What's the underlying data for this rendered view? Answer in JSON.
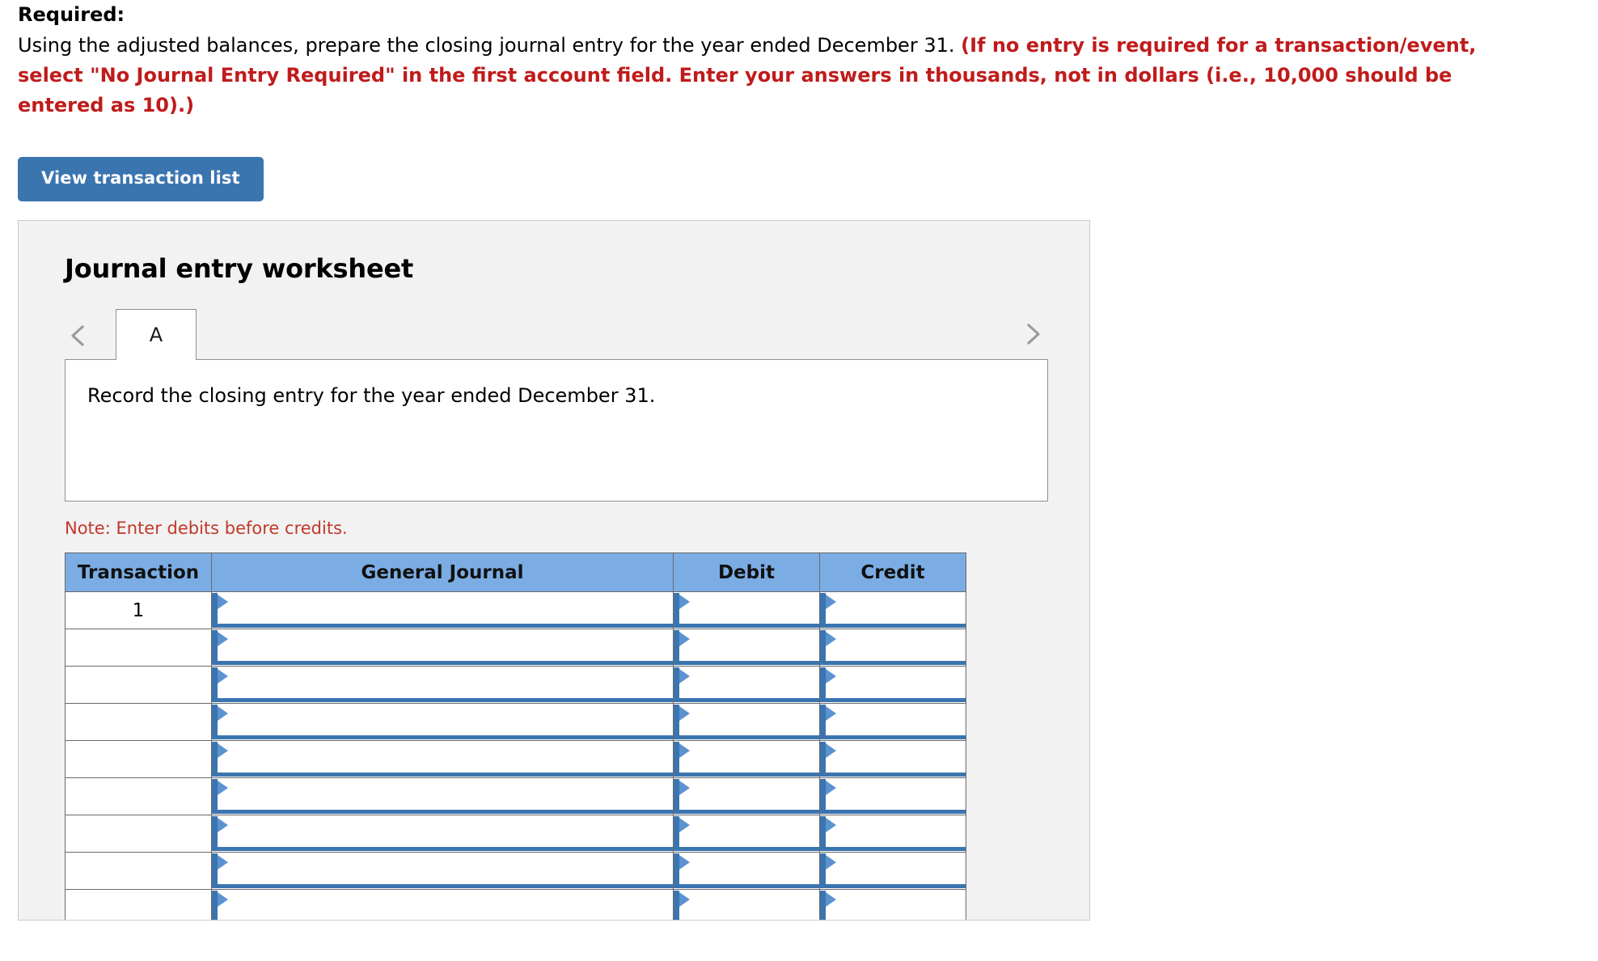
{
  "prompt": {
    "required_label": "Required:",
    "body_black": "Using the adjusted balances, prepare the closing journal entry for the year ended December 31.",
    "body_red": "(If no entry is required for a transaction/event, select \"No Journal Entry Required\" in the first account field. Enter your answers in thousands, not in dollars (i.e., 10,000 should be entered as 10).)"
  },
  "toolbar": {
    "view_transaction_list_label": "View transaction list"
  },
  "worksheet": {
    "title": "Journal entry worksheet",
    "prev_icon": "chevron-left-icon",
    "next_icon": "chevron-right-icon",
    "tabs": [
      {
        "label": "A",
        "active": true
      }
    ],
    "scenario_text": "Record the closing entry for the year ended December 31.",
    "note": "Note: Enter debits before credits.",
    "table": {
      "columns": [
        "Transaction",
        "General Journal",
        "Debit",
        "Credit"
      ],
      "rows": [
        {
          "transaction": "1",
          "general_journal": "",
          "debit": "",
          "credit": ""
        },
        {
          "transaction": "",
          "general_journal": "",
          "debit": "",
          "credit": ""
        },
        {
          "transaction": "",
          "general_journal": "",
          "debit": "",
          "credit": ""
        },
        {
          "transaction": "",
          "general_journal": "",
          "debit": "",
          "credit": ""
        },
        {
          "transaction": "",
          "general_journal": "",
          "debit": "",
          "credit": ""
        },
        {
          "transaction": "",
          "general_journal": "",
          "debit": "",
          "credit": ""
        },
        {
          "transaction": "",
          "general_journal": "",
          "debit": "",
          "credit": ""
        },
        {
          "transaction": "",
          "general_journal": "",
          "debit": "",
          "credit": ""
        },
        {
          "transaction": "",
          "general_journal": "",
          "debit": "",
          "credit": ""
        }
      ]
    }
  },
  "colors": {
    "button_blue": "#3b75b0",
    "header_blue": "#7badE4",
    "select_blue": "#3b75b0",
    "red_text": "#c01b1b",
    "note_red": "#c0392b",
    "panel_bg": "#f2f2f2"
  }
}
